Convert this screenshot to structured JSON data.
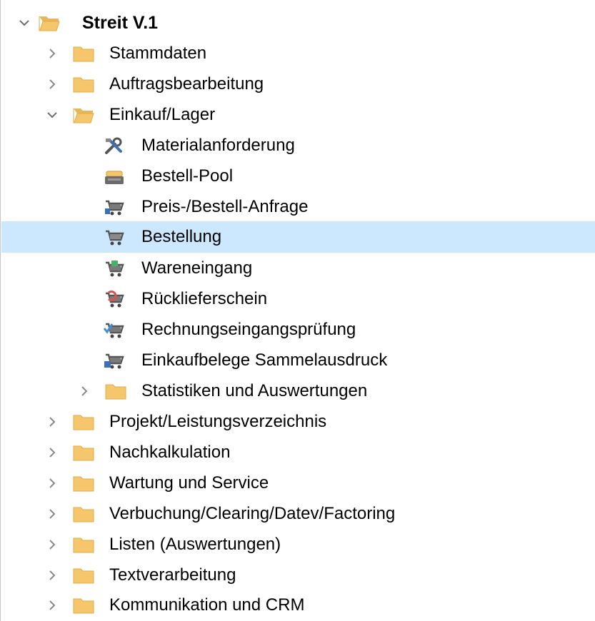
{
  "tree": {
    "root": {
      "label": "Streit V.1",
      "expanded": true,
      "icon": "folder-open-icon"
    },
    "level1": [
      {
        "label": "Stammdaten",
        "expanded": false,
        "icon": "folder-icon"
      },
      {
        "label": "Auftragsbearbeitung",
        "expanded": false,
        "icon": "folder-icon"
      },
      {
        "label": "Einkauf/Lager",
        "expanded": true,
        "icon": "folder-open-icon"
      },
      {
        "label": "Projekt/Leistungsverzeichnis",
        "expanded": false,
        "icon": "folder-icon"
      },
      {
        "label": "Nachkalkulation",
        "expanded": false,
        "icon": "folder-icon"
      },
      {
        "label": "Wartung und Service",
        "expanded": false,
        "icon": "folder-icon"
      },
      {
        "label": "Verbuchung/Clearing/Datev/Factoring",
        "expanded": false,
        "icon": "folder-icon"
      },
      {
        "label": "Listen (Auswertungen)",
        "expanded": false,
        "icon": "folder-icon"
      },
      {
        "label": "Textverarbeitung",
        "expanded": false,
        "icon": "folder-icon"
      },
      {
        "label": "Kommunikation und CRM",
        "expanded": false,
        "icon": "folder-icon"
      }
    ],
    "einkauf_children": [
      {
        "label": "Materialanforderung",
        "icon": "tools-icon"
      },
      {
        "label": "Bestell-Pool",
        "icon": "pool-tray-icon"
      },
      {
        "label": "Preis-/Bestell-Anfrage",
        "icon": "cart-blue-icon"
      },
      {
        "label": "Bestellung",
        "icon": "cart-icon",
        "selected": true
      },
      {
        "label": "Wareneingang",
        "icon": "cart-green-icon"
      },
      {
        "label": "Rücklieferschein",
        "icon": "cart-red-icon"
      },
      {
        "label": "Rechnungseingangsprüfung",
        "icon": "cart-check-icon"
      },
      {
        "label": "Einkaufbelege Sammelausdruck",
        "icon": "cart-print-icon"
      },
      {
        "label": "Statistiken und Auswertungen",
        "icon": "folder-icon",
        "expanded": false
      }
    ]
  },
  "colors": {
    "selection": "#cce8ff",
    "folder": "#f5c66b",
    "chevron": "#6e6e6e"
  }
}
